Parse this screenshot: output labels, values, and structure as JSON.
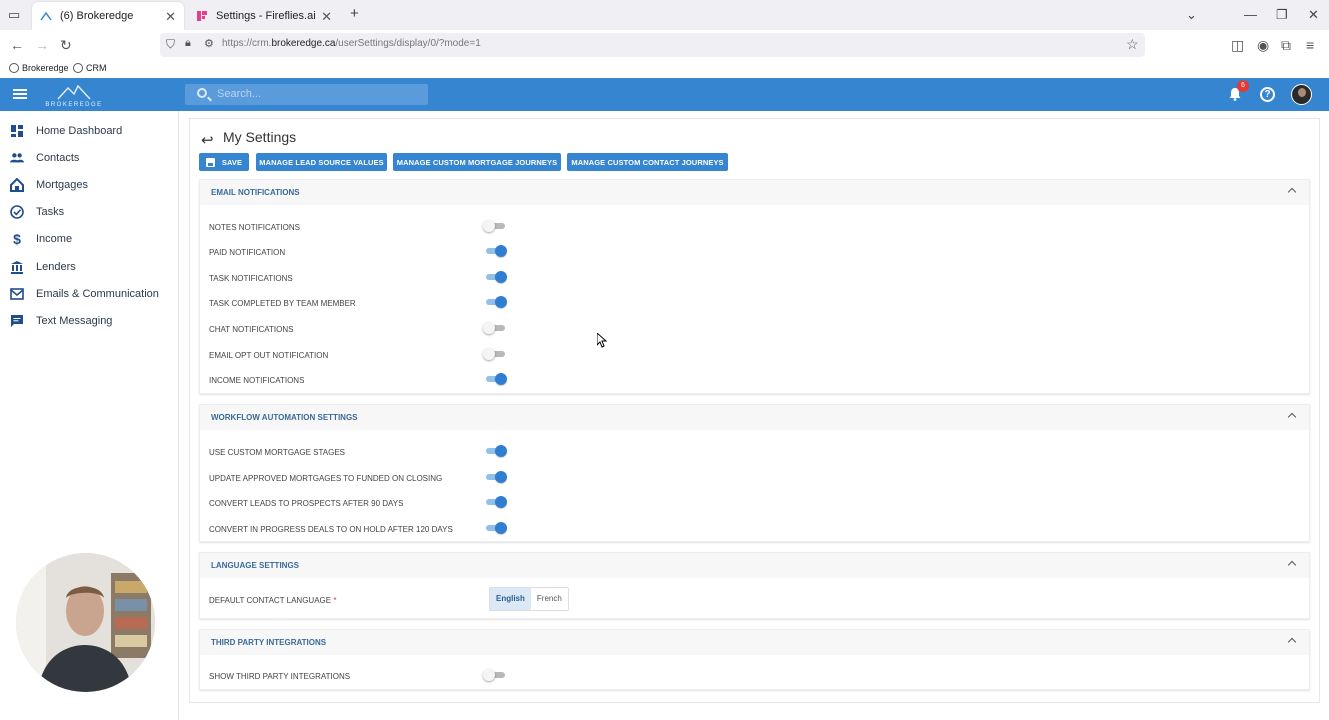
{
  "browser": {
    "tabs": [
      {
        "label": "(6) Brokeredge",
        "active": true
      },
      {
        "label": "Settings - Fireflies.ai",
        "active": false
      }
    ],
    "url_prefix": "https://crm.",
    "url_domain": "brokeredge.ca",
    "url_path": "/userSettings/display/0/?mode=1",
    "bookmarks": [
      "Brokeredge",
      "CRM"
    ]
  },
  "header": {
    "logo_text": "BROKEREDGE",
    "search_placeholder": "Search...",
    "notification_count": "6",
    "help_glyph": "?"
  },
  "sidebar": {
    "items": [
      {
        "label": "Home Dashboard",
        "icon": "dashboard-icon"
      },
      {
        "label": "Contacts",
        "icon": "people-icon"
      },
      {
        "label": "Mortgages",
        "icon": "house-icon"
      },
      {
        "label": "Tasks",
        "icon": "check-circle-icon"
      },
      {
        "label": "Income",
        "icon": "dollar-icon"
      },
      {
        "label": "Lenders",
        "icon": "bank-icon"
      },
      {
        "label": "Emails & Communication",
        "icon": "mail-icon"
      },
      {
        "label": "Text Messaging",
        "icon": "chat-icon"
      }
    ]
  },
  "page": {
    "title": "My Settings",
    "buttons": {
      "save": "SAVE",
      "lead_source": "MANAGE LEAD SOURCE VALUES",
      "mortgage_journeys": "MANAGE CUSTOM MORTGAGE JOURNEYS",
      "contact_journeys": "MANAGE CUSTOM CONTACT JOURNEYS"
    }
  },
  "email_notifications": {
    "title": "EMAIL NOTIFICATIONS",
    "rows": [
      {
        "label": "NOTES NOTIFICATIONS",
        "on": false
      },
      {
        "label": "PAID NOTIFICATION",
        "on": true
      },
      {
        "label": "TASK NOTIFICATIONS",
        "on": true
      },
      {
        "label": "TASK COMPLETED BY TEAM MEMBER",
        "on": true
      },
      {
        "label": "CHAT NOTIFICATIONS",
        "on": false
      },
      {
        "label": "EMAIL OPT OUT NOTIFICATION",
        "on": false
      },
      {
        "label": "INCOME NOTIFICATIONS",
        "on": true
      }
    ]
  },
  "workflow": {
    "title": "WORKFLOW AUTOMATION SETTINGS",
    "rows": [
      {
        "label": "USE CUSTOM MORTGAGE STAGES",
        "on": true
      },
      {
        "label": "UPDATE APPROVED MORTGAGES TO FUNDED ON CLOSING",
        "on": true
      },
      {
        "label": "CONVERT LEADS TO PROSPECTS AFTER 90 DAYS",
        "on": true
      },
      {
        "label": "CONVERT IN PROGRESS DEALS TO ON HOLD AFTER 120 DAYS",
        "on": true
      }
    ]
  },
  "language": {
    "title": "LANGUAGE SETTINGS",
    "label": "DEFAULT CONTACT LANGUAGE",
    "required_mark": "*",
    "options": [
      "English",
      "French"
    ],
    "selected": "English"
  },
  "third_party": {
    "title": "THIRD PARTY INTEGRATIONS",
    "rows": [
      {
        "label": "SHOW THIRD PARTY INTEGRATIONS",
        "on": false
      }
    ]
  },
  "colors": {
    "brand_blue": "#3585d1",
    "toggle_on": "#2f7ed0",
    "section_title": "#3a6a9a"
  }
}
